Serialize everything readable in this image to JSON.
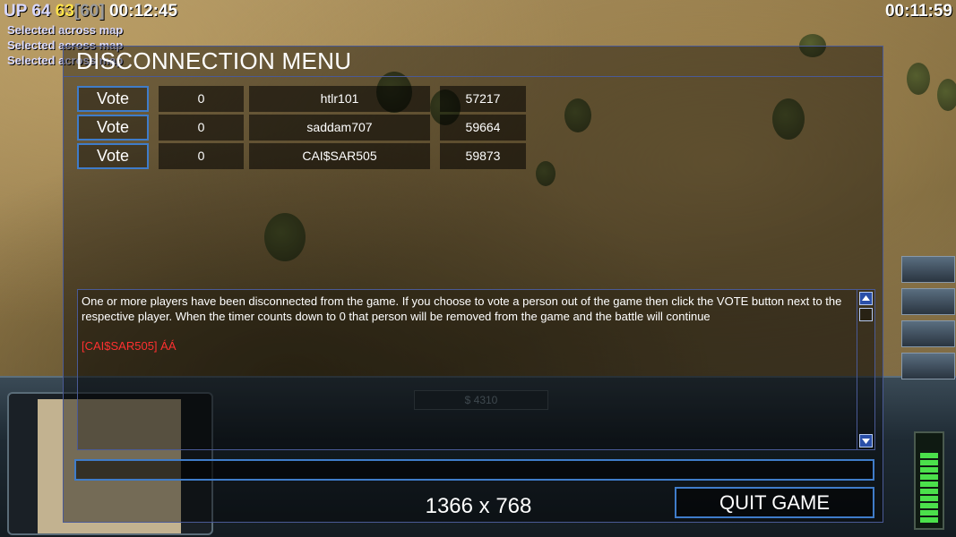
{
  "hud": {
    "up_label": "UP",
    "stat_a": "64",
    "stat_b": "63",
    "fps": "[60]",
    "game_time": "00:12:45",
    "countdown": "00:11:59",
    "messages": [
      "Selected across map",
      "Selected across map",
      "Selected across map"
    ]
  },
  "command_bar": {
    "cash": "$ 4310"
  },
  "dialog": {
    "title": "DISCONNECTION MENU",
    "vote_label": "Vote",
    "players": [
      {
        "votes": "0",
        "name": "htlr101",
        "ping": "57217"
      },
      {
        "votes": "0",
        "name": "saddam707",
        "ping": "59664"
      },
      {
        "votes": "0",
        "name": "CAI$SAR505",
        "ping": "59873"
      }
    ],
    "log": {
      "message": "One or more players have been disconnected from the game. If you choose to vote a person out of the game then click the VOTE button next to the respective player. When the timer counts down to 0 that person will be removed from the game and the battle will continue",
      "chat_line": "[CAI$SAR505] ÁÁ"
    },
    "chat_input": {
      "value": "",
      "placeholder": ""
    },
    "resolution": "1366 x 768",
    "quit_label": "QUIT GAME"
  },
  "colors": {
    "accent_border": "#3f7cc9",
    "panel_border": "#4a5a96",
    "chat_red": "#ff3030",
    "hud_yellow": "#ffe24a"
  },
  "icons": [
    "scroll-up-icon",
    "scroll-down-icon",
    "power-meter-icon"
  ]
}
